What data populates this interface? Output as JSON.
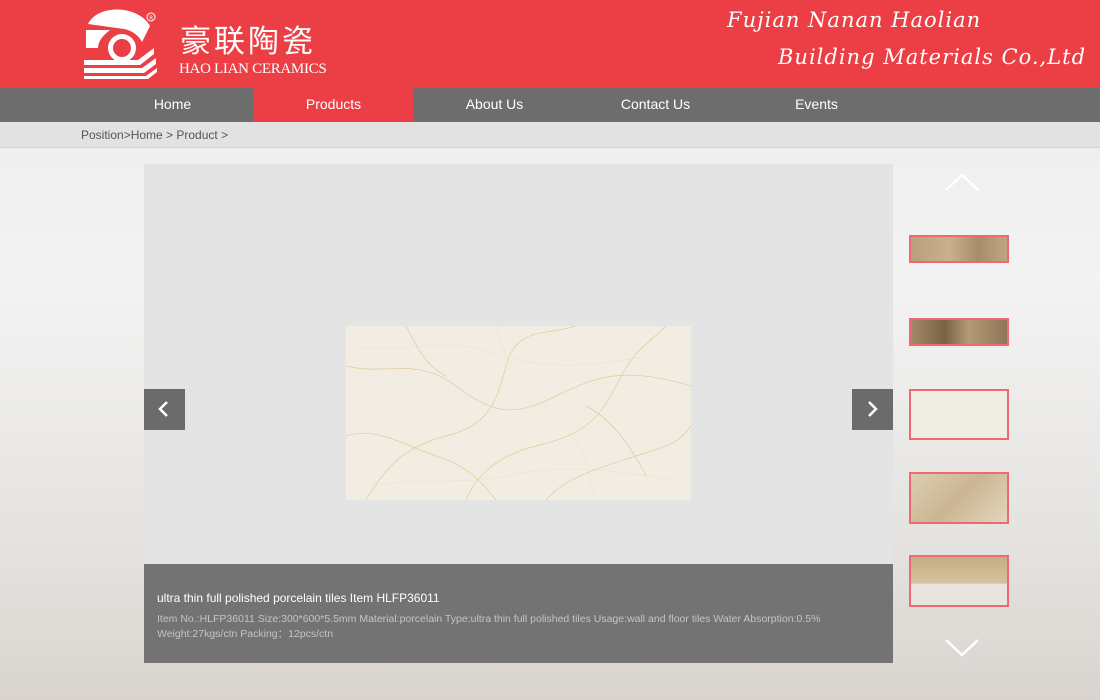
{
  "header": {
    "logo_cn": "豪联陶瓷",
    "logo_en": "HAO LIAN CERAMICS",
    "company_line1": "Fujian Nanan Haolian",
    "company_line2": "Building Materials Co.,Ltd",
    "brand_color": "#ec3e45"
  },
  "nav": {
    "items": [
      {
        "label": "Home"
      },
      {
        "label": "Products",
        "active": true
      },
      {
        "label": "About Us"
      },
      {
        "label": "Contact Us"
      },
      {
        "label": "Events"
      }
    ]
  },
  "breadcrumb": "Position>Home > Product >",
  "product": {
    "title": "ultra thin full polished porcelain tiles Item HLFP36011",
    "description": "Item No.:HLFP36011 Size:300*600*5.5mm Material:porcelain Type:ultra thin full polished tiles Usage:wall and floor tiles Water Absorption:0.5% Weight:27kgs/ctn Packing：12pcs/ctn"
  },
  "icons": {
    "prev": "chevron-left-icon",
    "next": "chevron-right-icon",
    "up": "chevron-up-icon",
    "down": "chevron-down-icon"
  }
}
